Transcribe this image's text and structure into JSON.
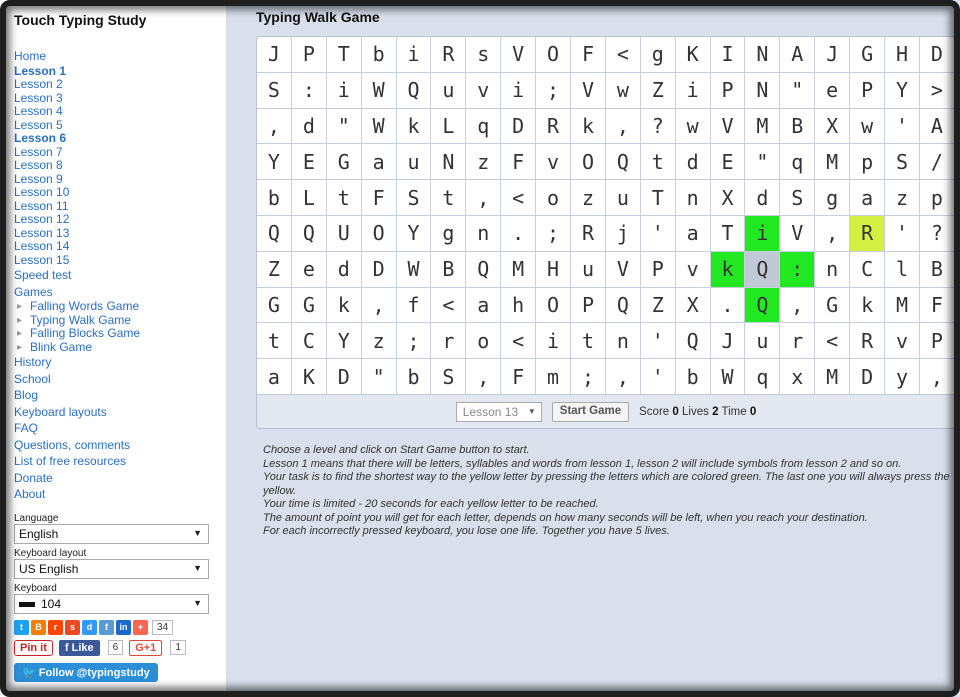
{
  "site_title": "Touch Typing Study",
  "nav": {
    "home": "Home",
    "lessons": [
      "Lesson 1",
      "Lesson 2",
      "Lesson 3",
      "Lesson 4",
      "Lesson 5",
      "Lesson 6",
      "Lesson 7",
      "Lesson 8",
      "Lesson 9",
      "Lesson 10",
      "Lesson 11",
      "Lesson 12",
      "Lesson 13",
      "Lesson 14",
      "Lesson 15"
    ],
    "speed_test": "Speed test",
    "games": "Games",
    "game_items": [
      "Falling Words Game",
      "Typing Walk Game",
      "Falling Blocks Game",
      "Blink Game"
    ],
    "links": [
      "History",
      "School",
      "Blog",
      "Keyboard layouts",
      "FAQ",
      "Questions, comments",
      "List of free resources",
      "Donate",
      "About"
    ]
  },
  "language": {
    "label": "Language",
    "value": "English"
  },
  "keyboard_layout": {
    "label": "Keyboard layout",
    "value": "US English"
  },
  "keyboard": {
    "label": "Keyboard",
    "value": "104"
  },
  "share": {
    "count": "34",
    "pin_label": "Pin it",
    "like_label": "Like",
    "like_count": "6",
    "gplus_label": "G+1",
    "gplus_count": "1",
    "follow_label": "Follow @typingstudy"
  },
  "game": {
    "title": "Typing Walk Game",
    "grid": [
      [
        "J",
        "P",
        "T",
        "b",
        "i",
        "R",
        "s",
        "V",
        "O",
        "F",
        "<",
        "g",
        "K",
        "I",
        "N",
        "A",
        "J",
        "G",
        "H",
        "D"
      ],
      [
        "S",
        ":",
        "i",
        "W",
        "Q",
        "u",
        "v",
        "i",
        ";",
        "V",
        "w",
        "Z",
        "i",
        "P",
        "N",
        "\"",
        "e",
        "P",
        "Y",
        ">"
      ],
      [
        ",",
        "d",
        "\"",
        "W",
        "k",
        "L",
        "q",
        "D",
        "R",
        "k",
        ",",
        "?",
        "w",
        "V",
        "M",
        "B",
        "X",
        "w",
        "'",
        "A"
      ],
      [
        "Y",
        "E",
        "G",
        "a",
        "u",
        "N",
        "z",
        "F",
        "v",
        "O",
        "Q",
        "t",
        "d",
        "E",
        "\"",
        "q",
        "M",
        "p",
        "S",
        "/"
      ],
      [
        "b",
        "L",
        "t",
        "F",
        "S",
        "t",
        ",",
        "<",
        "o",
        "z",
        "u",
        "T",
        "n",
        "X",
        "d",
        "S",
        "g",
        "a",
        "z",
        "p"
      ],
      [
        "Q",
        "Q",
        "U",
        "O",
        "Y",
        "g",
        "n",
        ".",
        ";",
        "R",
        "j",
        "'",
        "a",
        "T",
        "i",
        "V",
        ",",
        "R",
        "'",
        "?"
      ],
      [
        "Z",
        "e",
        "d",
        "D",
        "W",
        "B",
        "Q",
        "M",
        "H",
        "u",
        "V",
        "P",
        "v",
        "k",
        "Q",
        ":",
        "n",
        "C",
        "l",
        "B"
      ],
      [
        "G",
        "G",
        "k",
        ",",
        "f",
        "<",
        "a",
        "h",
        "O",
        "P",
        "Q",
        "Z",
        "X",
        ".",
        "Q",
        ",",
        "G",
        "k",
        "M",
        "F"
      ],
      [
        "t",
        "C",
        "Y",
        "z",
        ";",
        "r",
        "o",
        "<",
        "i",
        "t",
        "n",
        "'",
        "Q",
        "J",
        "u",
        "r",
        "<",
        "R",
        "v",
        "P"
      ],
      [
        "a",
        "K",
        "D",
        "\"",
        "b",
        "S",
        ",",
        "F",
        "m",
        ";",
        ",",
        "'",
        "b",
        "W",
        "q",
        "x",
        "M",
        "D",
        "y",
        ","
      ]
    ],
    "green_cells": [
      [
        5,
        14
      ],
      [
        6,
        13
      ],
      [
        6,
        15
      ],
      [
        7,
        14
      ]
    ],
    "current_cell": [
      6,
      14
    ],
    "target_cell": [
      5,
      17
    ],
    "level_select": "Lesson 13",
    "start_label": "Start Game",
    "score_label": "Score",
    "score": "0",
    "lives_label": "Lives",
    "lives": "2",
    "time_label": "Time",
    "time": "0"
  },
  "instructions": [
    "Choose a level and click on Start Game button to start.",
    "Lesson 1 means that there will be letters, syllables and words from lesson 1, lesson 2 will include symbols from lesson 2 and so on.",
    "Your task is to find the shortest way to the yellow letter by pressing the letters which are colored green. The last one you will always press the yellow.",
    "Your time is limited - 20 seconds for each yellow letter to be reached.",
    "The amount of point you will get for each letter, depends on how many seconds will be left, when you reach your destination.",
    "For each incorrectly pressed keyboard, you lose one life. Together you have 5 lives."
  ],
  "colors": {
    "link": "#2a6fbf",
    "green": "#22e822",
    "yellow": "#d4f040",
    "main_bg": "#d9dfeb"
  }
}
